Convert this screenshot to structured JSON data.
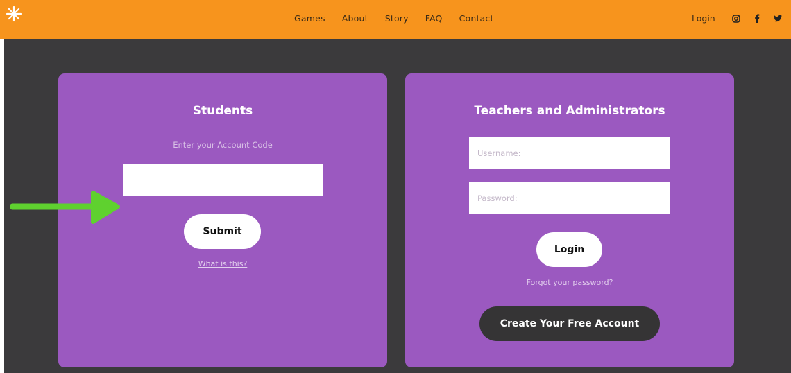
{
  "header": {
    "logo_icon": "asterisk-logo-icon",
    "nav": [
      "Games",
      "About",
      "Story",
      "FAQ",
      "Contact"
    ],
    "login_label": "Login",
    "social_icons": [
      "instagram-icon",
      "facebook-icon",
      "twitter-icon"
    ],
    "bar_color": "#f7941d"
  },
  "students": {
    "title": "Students",
    "hint": "Enter your Account Code",
    "code_value": "",
    "submit_label": "Submit",
    "help_link": "What is this?"
  },
  "teachers": {
    "title": "Teachers and Administrators",
    "username_placeholder": "Username:",
    "password_placeholder": "Password:",
    "login_label": "Login",
    "forgot_link": "Forgot your password?",
    "create_label": "Create Your Free Account"
  },
  "colors": {
    "card": "#9b59c0",
    "background": "#3b3a3c",
    "annotation_arrow": "#5fd12f"
  },
  "annotation": {
    "arrow_icon": "green-arrow-icon"
  }
}
